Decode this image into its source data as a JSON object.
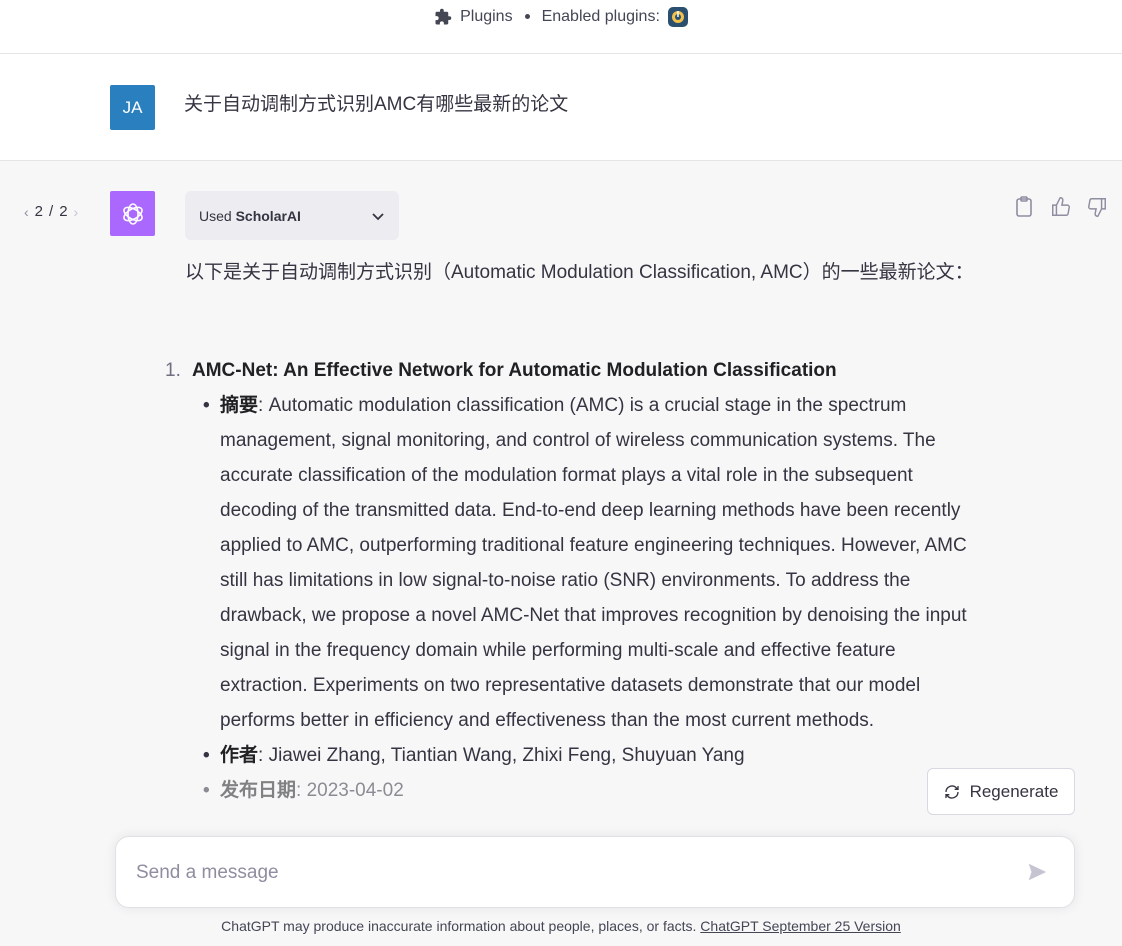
{
  "header": {
    "plugins_label": "Plugins",
    "enabled_label": "Enabled plugins:"
  },
  "user_message": {
    "avatar_initials": "JA",
    "text": "关于自动调制方式识别AMC有哪些最新的论文"
  },
  "assistant": {
    "pager": {
      "current": "2",
      "separator": "/",
      "total": "2"
    },
    "used_plugin": {
      "prefix": "Used",
      "name": "ScholarAI"
    },
    "intro": "以下是关于自动调制方式识别（Automatic Modulation Classification, AMC）的一些最新论文：",
    "papers": [
      {
        "number": "1.",
        "title": "AMC-Net: An Effective Network for Automatic Modulation Classification",
        "abstract_label": "摘要",
        "abstract": ": Automatic modulation classification (AMC) is a crucial stage in the spectrum management, signal monitoring, and control of wireless communication systems. The accurate classification of the modulation format plays a vital role in the subsequent decoding of the transmitted data. End-to-end deep learning methods have been recently applied to AMC, outperforming traditional feature engineering techniques. However, AMC still has limitations in low signal-to-noise ratio (SNR) environments. To address the drawback, we propose a novel AMC-Net that improves recognition by denoising the input signal in the frequency domain while performing multi-scale and effective feature extraction. Experiments on two representative datasets demonstrate that our model performs better in efficiency and effectiveness than the most current methods.",
        "authors_label": "作者",
        "authors": ": Jiawei Zhang, Tiantian Wang, Zhixi Feng, Shuyuan Yang",
        "date_label": "发布日期",
        "date": ": 2023-04-02"
      }
    ]
  },
  "regenerate_label": "Regenerate",
  "composer": {
    "placeholder": "Send a message"
  },
  "footer": {
    "disclaimer": "ChatGPT may produce inaccurate information about people, places, or facts. ",
    "version_link": "ChatGPT September 25 Version"
  },
  "colors": {
    "user_avatar": "#2a7fbf",
    "assistant_avatar": "#ab68ff",
    "assistant_bg": "#f7f7f8"
  }
}
